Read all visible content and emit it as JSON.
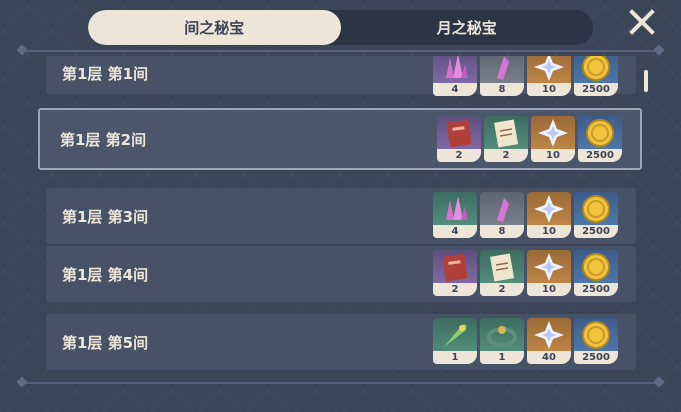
{
  "tabs": [
    {
      "label": "间之秘宝",
      "active": true
    },
    {
      "label": "月之秘宝",
      "active": false
    }
  ],
  "close_icon": "close-icon",
  "rows": [
    {
      "label": "第1层 第1间",
      "selected": false,
      "rewards": [
        {
          "icon": "crystal-cluster-icon",
          "rarity": "purple",
          "count": "4"
        },
        {
          "icon": "crystal-chunk-icon",
          "rarity": "grey",
          "count": "8"
        },
        {
          "icon": "star-gem-icon",
          "rarity": "gold",
          "count": "10"
        },
        {
          "icon": "mora-coin-icon",
          "rarity": "blue",
          "count": "2500"
        }
      ]
    },
    {
      "label": "第1层 第2间",
      "selected": true,
      "rewards": [
        {
          "icon": "red-book-icon",
          "rarity": "purple",
          "count": "2"
        },
        {
          "icon": "scroll-icon",
          "rarity": "green",
          "count": "2"
        },
        {
          "icon": "star-gem-icon",
          "rarity": "gold",
          "count": "10"
        },
        {
          "icon": "mora-coin-icon",
          "rarity": "blue",
          "count": "2500"
        }
      ]
    },
    {
      "label": "第1层 第3间",
      "selected": false,
      "rewards": [
        {
          "icon": "crystal-cluster-icon",
          "rarity": "green",
          "count": "4"
        },
        {
          "icon": "crystal-chunk-icon",
          "rarity": "grey",
          "count": "8"
        },
        {
          "icon": "star-gem-icon",
          "rarity": "gold",
          "count": "10"
        },
        {
          "icon": "mora-coin-icon",
          "rarity": "blue",
          "count": "2500"
        }
      ]
    },
    {
      "label": "第1层 第4间",
      "selected": false,
      "rewards": [
        {
          "icon": "red-book-icon",
          "rarity": "purple",
          "count": "2"
        },
        {
          "icon": "scroll-icon",
          "rarity": "green",
          "count": "2"
        },
        {
          "icon": "star-gem-icon",
          "rarity": "gold",
          "count": "10"
        },
        {
          "icon": "mora-coin-icon",
          "rarity": "blue",
          "count": "2500"
        }
      ]
    },
    {
      "label": "第1层 第5间",
      "selected": false,
      "rewards": [
        {
          "icon": "feather-icon",
          "rarity": "green",
          "count": "1"
        },
        {
          "icon": "sands-artifact-icon",
          "rarity": "green",
          "count": "1"
        },
        {
          "icon": "star-gem-icon",
          "rarity": "gold",
          "count": "40"
        },
        {
          "icon": "mora-coin-icon",
          "rarity": "blue",
          "count": "2500"
        }
      ]
    }
  ]
}
